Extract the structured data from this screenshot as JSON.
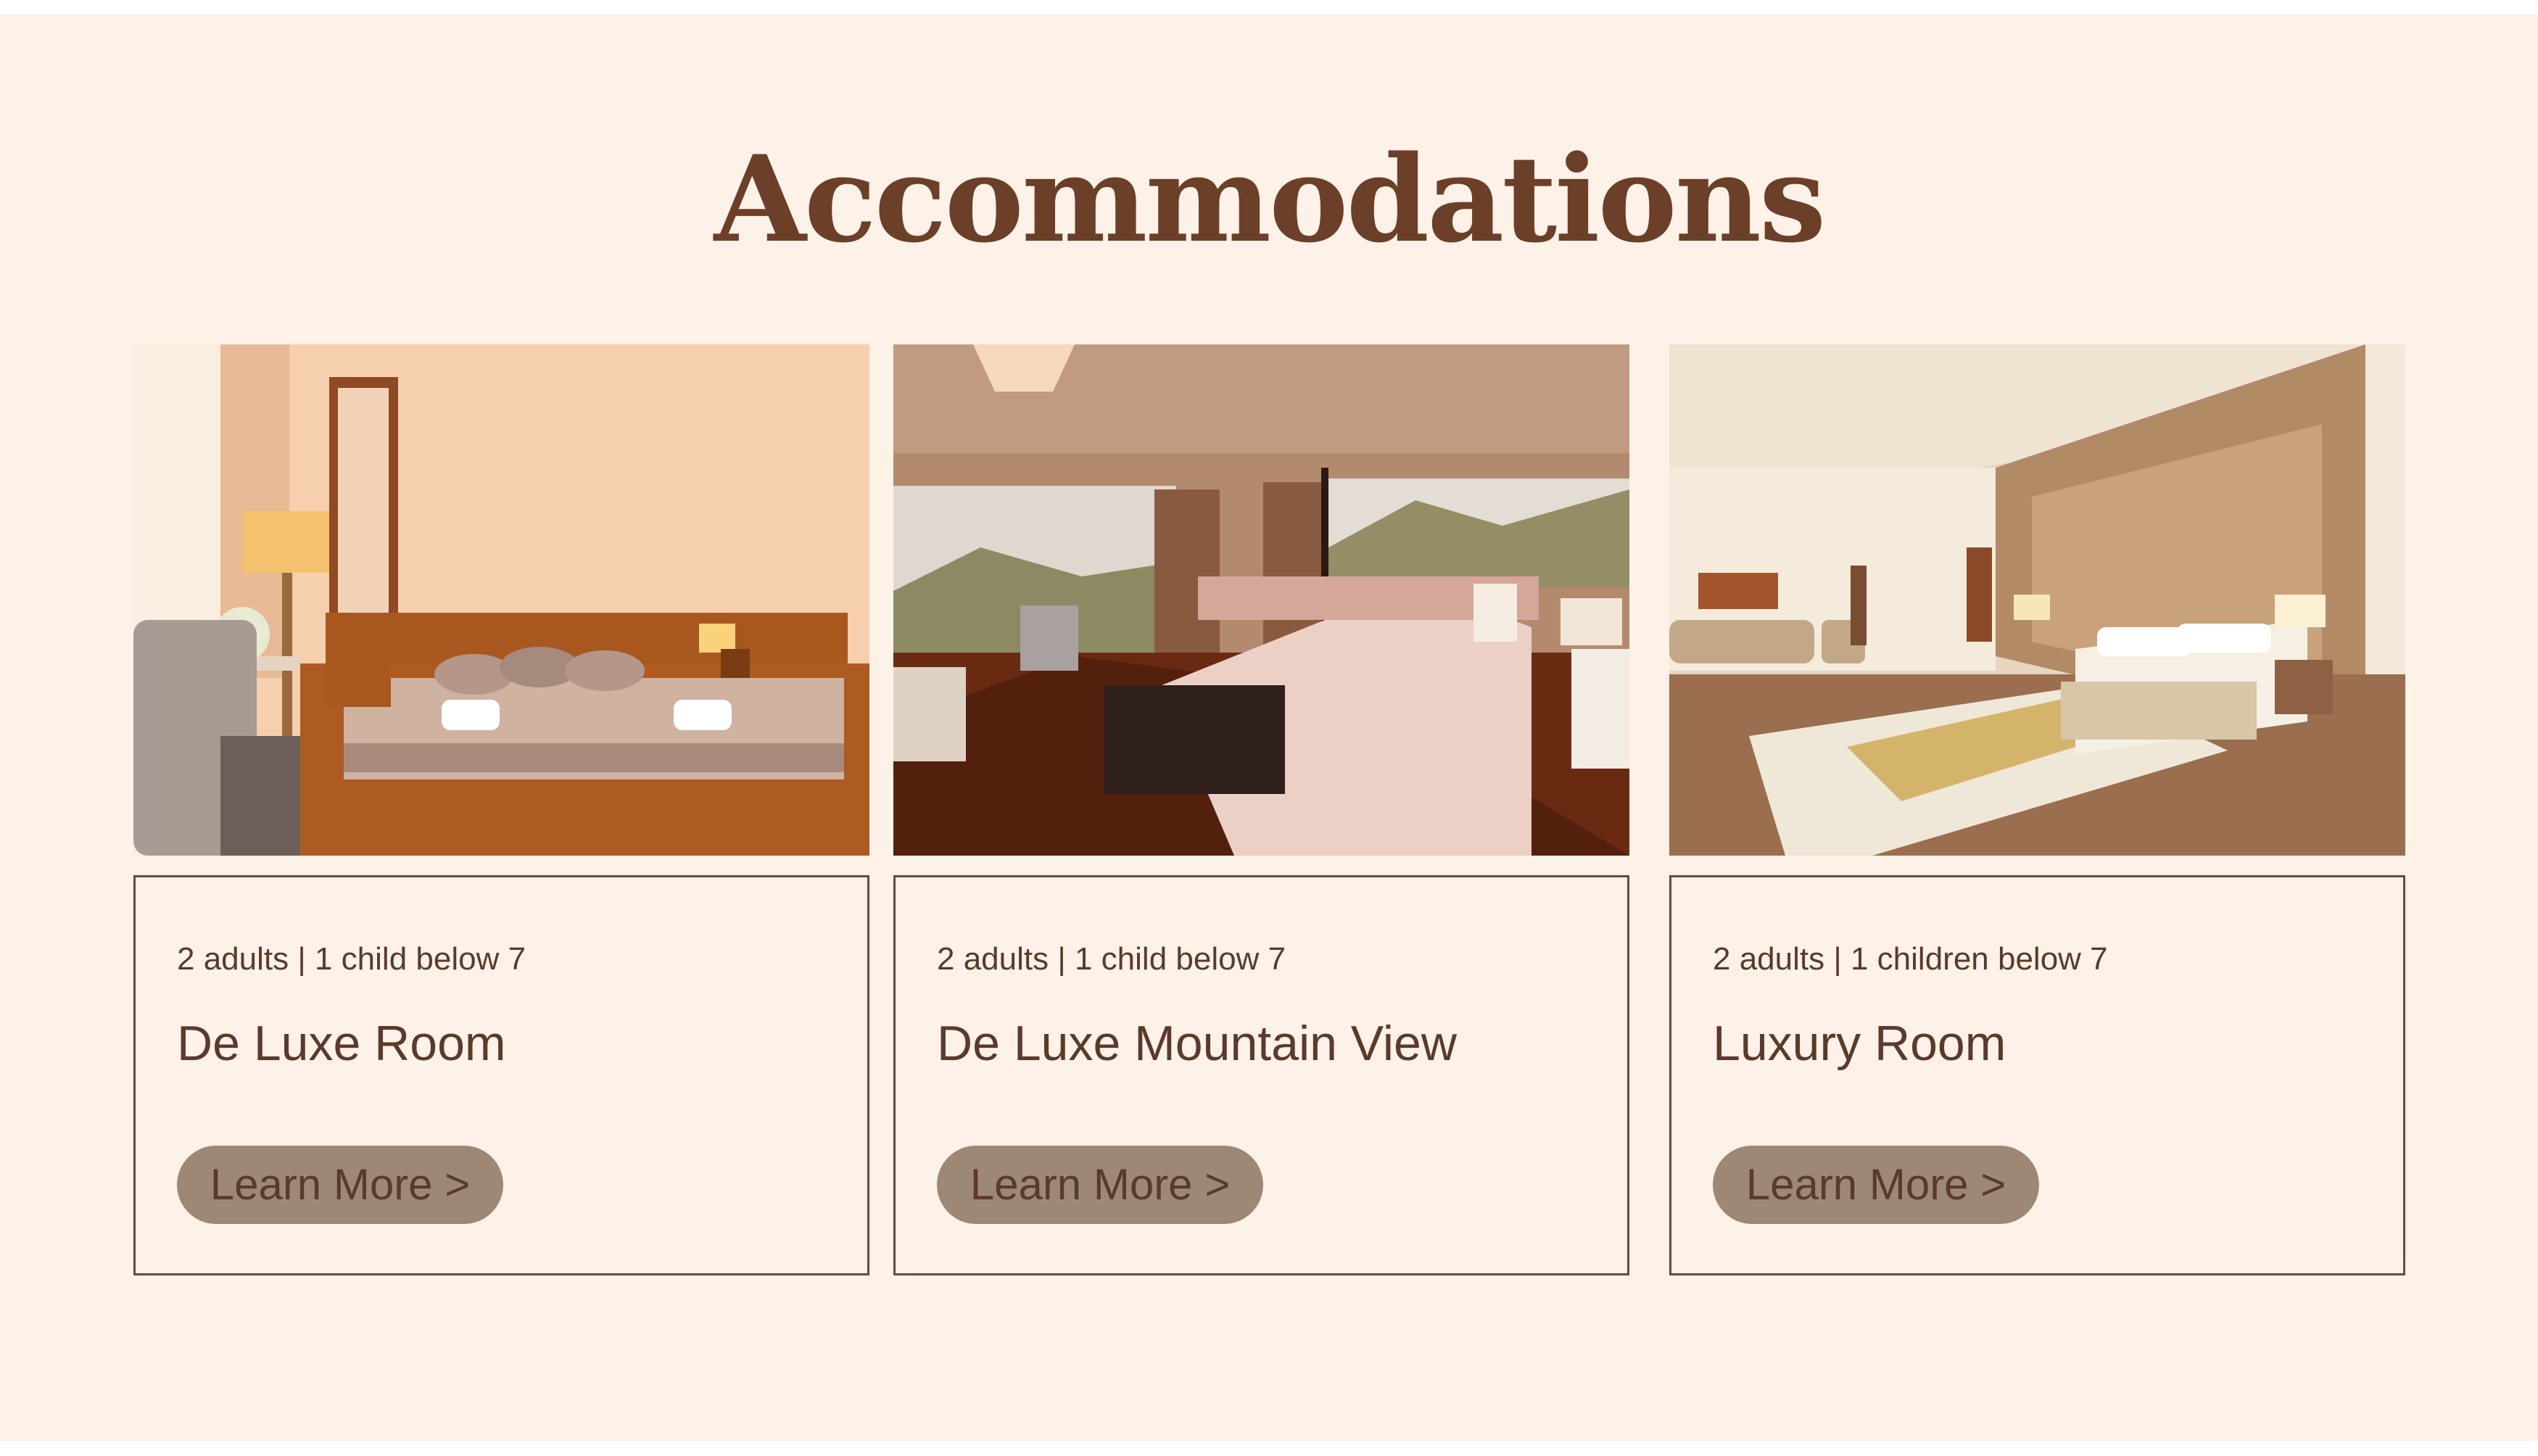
{
  "heading": "Accommodations",
  "colors": {
    "background": "#fdf1e8",
    "heading": "#6b3f28",
    "text": "#5a3a2a",
    "border": "#6a4a38",
    "button": "#9c8874"
  },
  "rooms": [
    {
      "occupancy": "2 adults | 1 child below 7",
      "title": "De Luxe Room",
      "button_label": "Learn More >"
    },
    {
      "occupancy": "2 adults | 1 child below 7",
      "title": "De Luxe Mountain View",
      "button_label": "Learn More >"
    },
    {
      "occupancy": "2 adults | 1 children below 7",
      "title": "Luxury Room",
      "button_label": "Learn More >"
    }
  ]
}
